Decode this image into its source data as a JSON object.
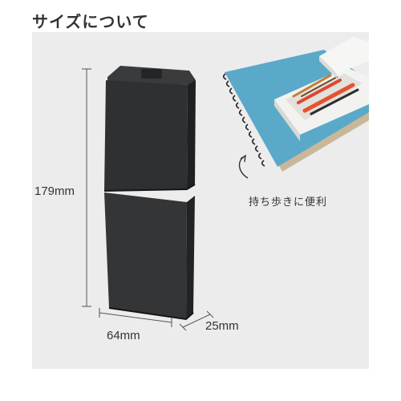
{
  "title": "サイズについて",
  "dimensions": {
    "height": "179mm",
    "width": "64mm",
    "depth": "25mm"
  },
  "caption": "持ち歩きに便利",
  "colors": {
    "panel_background": "#ececec",
    "case_body": "#2f3032",
    "notebook_cover": "#5aa9c9",
    "tray": "#f2f2f0"
  }
}
